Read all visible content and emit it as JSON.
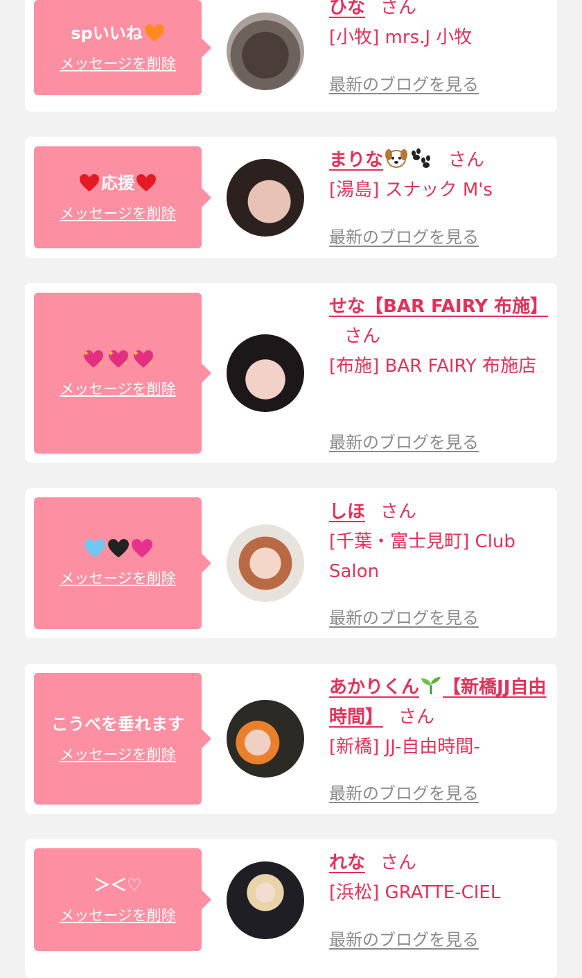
{
  "common": {
    "delete_label": "メッセージを削除",
    "blog_label": "最新のブログを見る",
    "san": "さん"
  },
  "cards": [
    {
      "message": "spいいね",
      "message_emoji": [
        "orange-heart"
      ],
      "name": "ひな",
      "shop": "[小牧] mrs.J 小牧",
      "name_emoji": []
    },
    {
      "message": "応援",
      "message_emoji": [
        "red-heart",
        "red-heart"
      ],
      "name": "まりな",
      "shop": "[湯島] スナック M's",
      "name_emoji": [
        "dog-face",
        "paw-prints"
      ]
    },
    {
      "message": "",
      "message_emoji": [
        "sparkling-heart",
        "sparkling-heart",
        "sparkling-heart"
      ],
      "name": "せな【BAR FAIRY 布施】",
      "shop": "[布施] BAR FAIRY 布施店",
      "name_emoji": []
    },
    {
      "message": "",
      "message_emoji": [
        "light-blue-heart",
        "black-heart",
        "pink-heart"
      ],
      "name": "しほ",
      "shop": "[千葉・富士見町] Club Salon",
      "name_emoji": []
    },
    {
      "message": "こうべを垂れます",
      "message_emoji": [],
      "name": "あかりくん",
      "name_suffix": "【新橋JJ自由時間】",
      "shop": "[新橋] JJ-自由時間-",
      "name_emoji": [
        "seedling"
      ]
    },
    {
      "message": "＞＜♡",
      "message_emoji": [],
      "name": "れな",
      "shop": "[浜松] GRATTE-CIEL",
      "name_emoji": []
    }
  ],
  "colors": {
    "background": "#f2f2f2",
    "card": "#ffffff",
    "bubble": "#fd8fa2",
    "accent": "#e3315a",
    "blog_link": "#8a8a8a"
  }
}
